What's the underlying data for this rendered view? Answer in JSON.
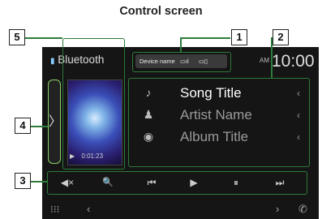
{
  "heading": "Control screen",
  "callouts": {
    "c1": "1",
    "c2": "2",
    "c3": "3",
    "c4": "4",
    "c5": "5"
  },
  "status": {
    "source": "Bluetooth",
    "device": "Device name",
    "clock_am": "AM",
    "clock_time": "10:00"
  },
  "art": {
    "time": "0:01:23"
  },
  "side_tab": {
    "chevron": "〉"
  },
  "info": [
    {
      "icon": "♪",
      "text": "Song Title",
      "color": "#ffffff"
    },
    {
      "icon": "♟",
      "text": "Artist Name",
      "color": "#9a9a9a"
    },
    {
      "icon": "◉",
      "text": "Album Title",
      "color": "#9a9a9a"
    }
  ],
  "info_chevron": "‹",
  "controls": [
    "◀×",
    "🔍",
    "⏮",
    "▶",
    "⏸",
    "⏭"
  ],
  "bottom": {
    "menu": "⁝⁝⁝",
    "back": "‹",
    "next": "›",
    "phone": "✆"
  },
  "colors": {
    "accent": "#2e7a3a",
    "screen": "#151515",
    "tab_border": "#8ad06a"
  }
}
